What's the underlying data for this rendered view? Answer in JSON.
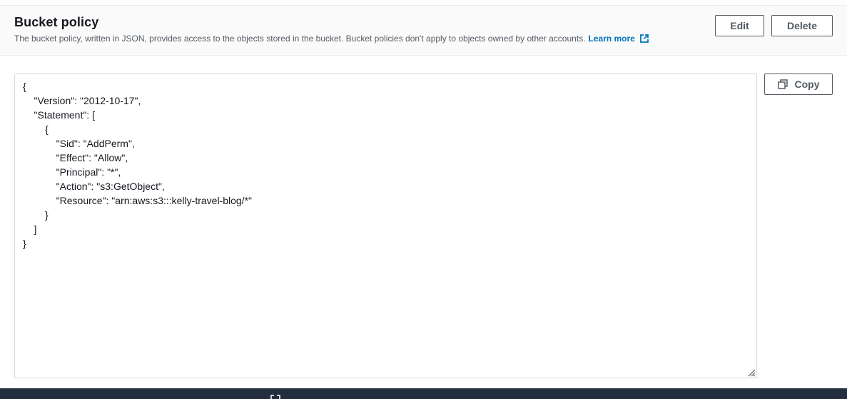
{
  "header": {
    "title": "Bucket policy",
    "description": "The bucket policy, written in JSON, provides access to the objects stored in the bucket. Bucket policies don't apply to objects owned by other accounts.",
    "learn_more": "Learn more",
    "edit_label": "Edit",
    "delete_label": "Delete"
  },
  "policy": {
    "json": "{\n    \"Version\": \"2012-10-17\",\n    \"Statement\": [\n        {\n            \"Sid\": \"AddPerm\",\n            \"Effect\": \"Allow\",\n            \"Principal\": \"*\",\n            \"Action\": \"s3:GetObject\",\n            \"Resource\": \"arn:aws:s3:::kelly-travel-blog/*\"\n        }\n    ]\n}"
  },
  "copy_label": "Copy",
  "icons": {
    "external_link": "external-link-icon",
    "copy": "copy-icon",
    "resize": "resize-handle-icon"
  },
  "colors": {
    "link": "#0073bb",
    "button_border": "#545b64",
    "footer_bar": "#232f3e"
  }
}
